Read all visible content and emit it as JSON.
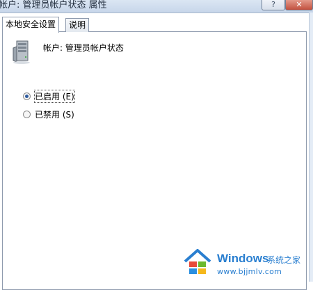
{
  "window": {
    "title": "帐户: 管理员帐户状态 属性",
    "help_label": "?",
    "close_label": "✕"
  },
  "tabs": [
    {
      "label": "本地安全设置",
      "active": true
    },
    {
      "label": "说明",
      "active": false
    }
  ],
  "policy": {
    "icon": "server-icon",
    "label": "帐户: 管理员帐户状态"
  },
  "options": [
    {
      "label": "已启用 (E)",
      "checked": true
    },
    {
      "label": "已禁用 (S)",
      "checked": false
    }
  ],
  "watermark": {
    "brand": "Windows",
    "subtitle": "系统之家",
    "url": "www.bjjmlv.com"
  },
  "colors": {
    "accent": "#2a7fd0",
    "radio_dot": "#2c5a9e"
  }
}
